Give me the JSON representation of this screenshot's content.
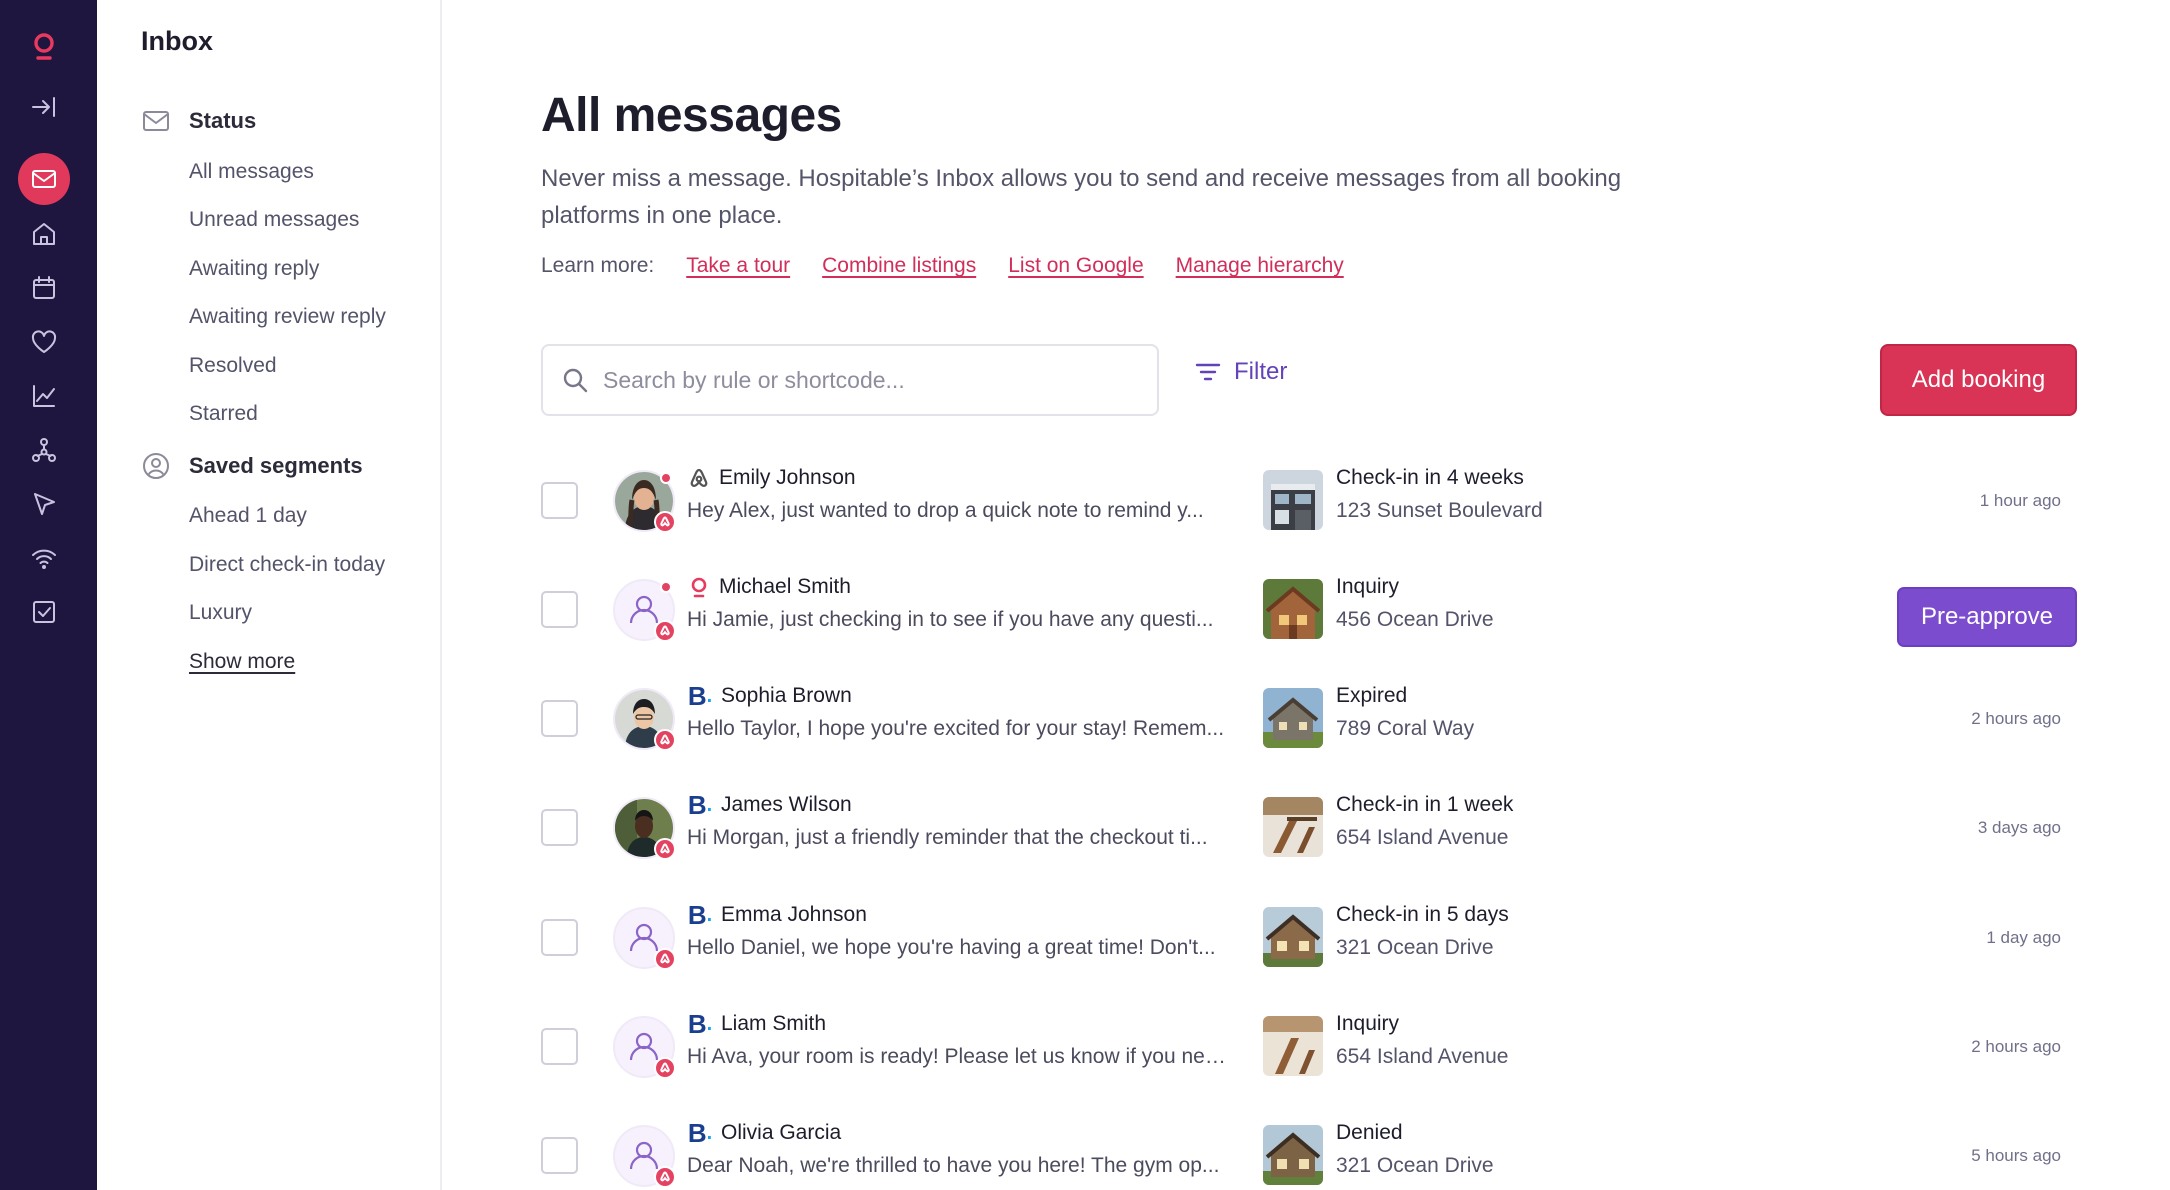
{
  "app": {
    "brand_color": "#e8395f",
    "rail_bg": "#1f1640",
    "rail_icons": [
      "logo-icon",
      "collapse-icon",
      "inbox-icon",
      "home-icon",
      "calendar-icon",
      "heart-icon",
      "chart-icon",
      "network-icon",
      "send-icon",
      "wifi-icon",
      "checklist-icon"
    ],
    "active_rail": "inbox-icon"
  },
  "sidebar": {
    "title": "Inbox",
    "status_heading": "Status",
    "status_items": [
      "All messages",
      "Unread messages",
      "Awaiting reply",
      "Awaiting review reply",
      "Resolved",
      "Starred"
    ],
    "segments_heading": "Saved segments",
    "segment_items": [
      "Ahead 1 day",
      "Direct check-in today",
      "Luxury"
    ],
    "show_more": "Show more"
  },
  "main": {
    "title": "All messages",
    "description": "Never miss a message. Hospitable’s Inbox allows you to send and receive messages from all booking platforms in one place.",
    "learn_more_label": "Learn more:",
    "learn_links": [
      "Take a tour",
      "Combine listings",
      "List on Google",
      "Manage hierarchy"
    ],
    "search_placeholder": "Search by rule or shortcode...",
    "filter_label": "Filter",
    "add_booking_label": "Add booking"
  },
  "messages": [
    {
      "guest": "Emily Johnson",
      "platform": "airbnb",
      "avatar": "photo",
      "unread": true,
      "preview": "Hey Alex, just wanted to drop a quick note to remind y...",
      "status": "Check-in in 4 weeks",
      "address": "123 Sunset Boulevard",
      "time": "1 hour ago"
    },
    {
      "guest": "Michael Smith",
      "platform": "hospitable",
      "avatar": "generic",
      "unread": true,
      "preview": "Hi Jamie, just checking in to see if you have any questi...",
      "status": "Inquiry",
      "address": "456 Ocean Drive",
      "time": "",
      "action": "Pre-approve"
    },
    {
      "guest": "Sophia Brown",
      "platform": "booking",
      "avatar": "photo",
      "unread": false,
      "preview": "Hello Taylor, I hope you're excited for your stay! Remem...",
      "status": "Expired",
      "address": "789 Coral Way",
      "time": "2 hours ago"
    },
    {
      "guest": "James Wilson",
      "platform": "booking",
      "avatar": "photo",
      "unread": false,
      "preview": "Hi Morgan, just a friendly reminder that the checkout ti...",
      "status": "Check-in in 1 week",
      "address": "654 Island Avenue",
      "time": "3 days ago"
    },
    {
      "guest": "Emma Johnson",
      "platform": "booking",
      "avatar": "generic",
      "unread": false,
      "preview": "Hello Daniel, we hope you're having a great time! Don't...",
      "status": "Check-in in 5 days",
      "address": "321 Ocean Drive",
      "time": "1 day ago"
    },
    {
      "guest": "Liam Smith",
      "platform": "booking",
      "avatar": "generic",
      "unread": false,
      "preview": "Hi Ava, your room is ready! Please let us know if you nee...",
      "status": "Inquiry",
      "address": "654 Island Avenue",
      "time": "2 hours ago"
    },
    {
      "guest": "Olivia Garcia",
      "platform": "booking",
      "avatar": "generic",
      "unread": false,
      "preview": "Dear Noah, we're thrilled to have you here! The gym op...",
      "status": "Denied",
      "address": "321 Ocean Drive",
      "time": "5 hours ago"
    }
  ]
}
